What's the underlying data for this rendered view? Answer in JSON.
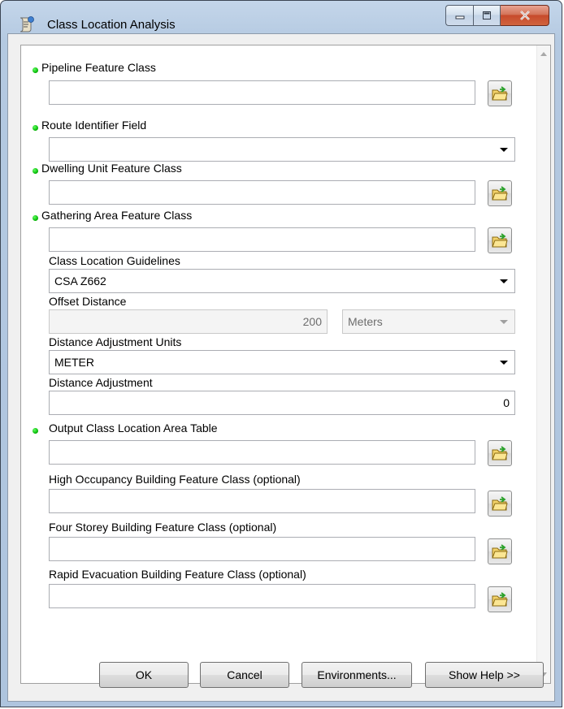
{
  "window": {
    "title": "Class Location Analysis",
    "icon": "tool-script-icon",
    "controls": [
      "minimize-icon",
      "maximize-icon",
      "close-icon"
    ]
  },
  "params": {
    "pipeline_fc": {
      "label": "Pipeline Feature Class",
      "value": "",
      "required": true
    },
    "route_id": {
      "label": "Route Identifier Field",
      "value": "",
      "required": true
    },
    "dwelling_fc": {
      "label": "Dwelling Unit Feature Class",
      "value": "",
      "required": true
    },
    "gathering_fc": {
      "label": "Gathering Area Feature Class",
      "value": "",
      "required": true
    },
    "guidelines": {
      "label": "Class Location Guidelines",
      "value": "CSA Z662"
    },
    "offset": {
      "label": "Offset Distance",
      "value": "200",
      "unit": "Meters"
    },
    "adj_units": {
      "label": "Distance Adjustment Units",
      "value": "METER"
    },
    "adj": {
      "label": "Distance Adjustment",
      "value": "0"
    },
    "output_table": {
      "label": "Output Class Location Area Table",
      "value": "",
      "required": true
    },
    "high_occ": {
      "label": "High Occupancy Building Feature Class (optional)",
      "value": ""
    },
    "four_storey": {
      "label": "Four Storey Building Feature Class (optional)",
      "value": ""
    },
    "rapid_evac": {
      "label": "Rapid Evacuation Building Feature Class (optional)",
      "value": ""
    }
  },
  "buttons": {
    "ok": "OK",
    "cancel": "Cancel",
    "environments": "Environments...",
    "show_help": "Show Help >>"
  },
  "colors": {
    "required_dot": "#00b000",
    "title_bar": "#b9cde4",
    "close_button": "#c74a2b"
  }
}
